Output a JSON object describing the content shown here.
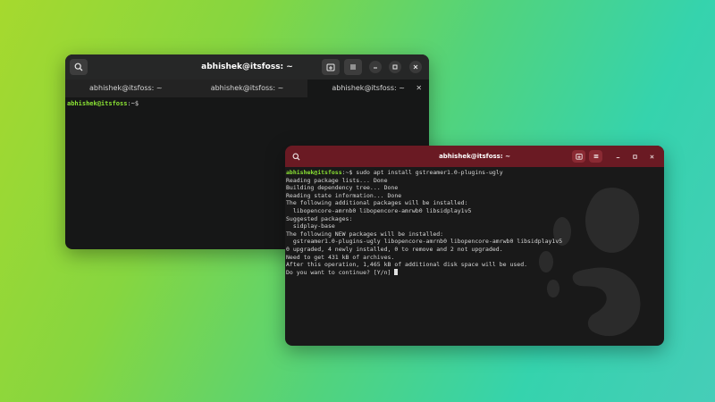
{
  "window1": {
    "title": "abhishek@itsfoss: ~",
    "tabs": [
      {
        "label": "abhishek@itsfoss: ~"
      },
      {
        "label": "abhishek@itsfoss: ~"
      },
      {
        "label": "abhishek@itsfoss: ~",
        "active": true
      }
    ],
    "prompt": "abhishek@itsfoss",
    "prompt_suffix": ":~$"
  },
  "window2": {
    "title": "abhishek@itsfoss: ~",
    "prompt": "abhishek@itsfoss",
    "prompt_suffix": ":~$ ",
    "command": "sudo apt install gstreamer1.0-plugins-ugly",
    "output": [
      "Reading package lists... Done",
      "Building dependency tree... Done",
      "Reading state information... Done",
      "The following additional packages will be installed:",
      "  libopencore-amrnb0 libopencore-amrwb0 libsidplay1v5",
      "Suggested packages:",
      "  sidplay-base",
      "The following NEW packages will be installed:",
      "  gstreamer1.0-plugins-ugly libopencore-amrnb0 libopencore-amrwb0 libsidplay1v5",
      "0 upgraded, 4 newly installed, 0 to remove and 2 not upgraded.",
      "Need to get 431 kB of archives.",
      "After this operation, 1,465 kB of additional disk space will be used."
    ],
    "final_prompt": "Do you want to continue? [Y/n] "
  },
  "icons": {
    "search": "search-icon",
    "new_tab": "new-tab-icon",
    "menu": "hamburger-menu-icon",
    "minimize": "minimize-icon",
    "maximize": "maximize-icon",
    "close": "close-icon"
  },
  "colors": {
    "prompt_green": "#8ae234",
    "titlebar_dark": "#262727",
    "titlebar_red": "#6a1a23",
    "terminal_bg": "#161717"
  }
}
